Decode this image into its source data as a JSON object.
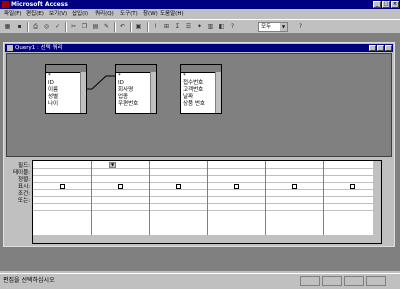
{
  "app": {
    "title": "Microsoft Access"
  },
  "menu": [
    "파일(F)",
    "편집(E)",
    "보기(V)",
    "삽입(I)",
    "쿼리(Q)",
    "도구(T)",
    "창(W)",
    "도움말(H)"
  ],
  "toolbar": {
    "combo_value": "모두",
    "sigma": "Σ"
  },
  "query_window": {
    "title": "Query1 : 선택 쿼리"
  },
  "tables": [
    {
      "fields": [
        "*",
        "ID",
        "이름",
        "성별",
        "나이"
      ]
    },
    {
      "fields": [
        "*",
        "ID",
        "회사명",
        "업종",
        "우편번호"
      ]
    },
    {
      "fields": [
        "*",
        "접수번호",
        "고객번호",
        "날짜",
        "상품 번호"
      ]
    }
  ],
  "grid": {
    "row_labels": [
      "필드:",
      "테이블:",
      "정렬:",
      "표시:",
      "조건:",
      "또는:"
    ]
  },
  "status": {
    "text": "편집을 선택하십시오"
  }
}
